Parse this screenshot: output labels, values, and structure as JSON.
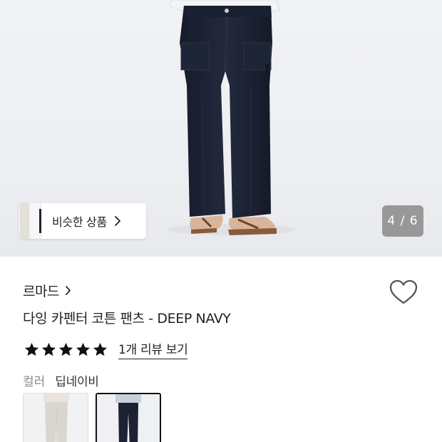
{
  "gallery": {
    "similar_label": "비슷한 상품",
    "counter": "4 / 6"
  },
  "product": {
    "brand": "르마드",
    "title": "다잉 카펜터 코튼 팬츠 - DEEP NAVY",
    "rating_stars": 5,
    "review_link": "1개 리뷰 보기",
    "color_label": "컬러",
    "color_value": "딥네이비",
    "swatches": [
      {
        "name": "light-gray-variant"
      },
      {
        "name": "deep-navy-variant",
        "selected": true
      }
    ]
  },
  "icons": [
    "chevron-right-icon",
    "heart-icon",
    "star-icon"
  ],
  "colors": {
    "pants_navy": "#1c2233",
    "counter_bg": "#808080",
    "star": "#111111",
    "muted_text": "#8a8a8a"
  }
}
